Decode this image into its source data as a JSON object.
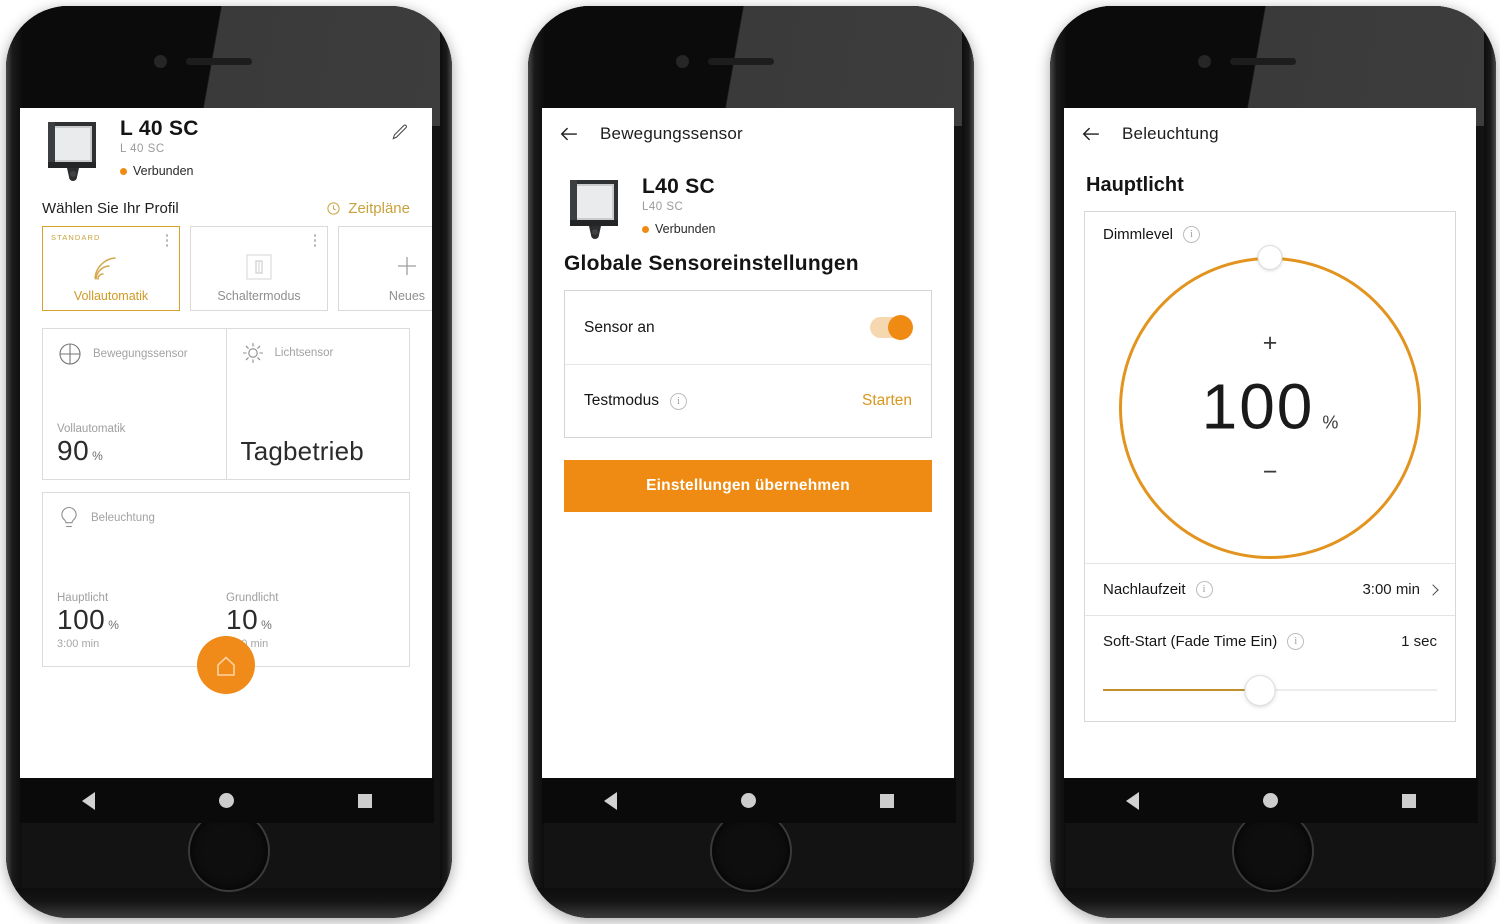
{
  "phone1": {
    "device": {
      "name": "L 40 SC",
      "model": "L 40 SC",
      "status": "Verbunden",
      "edit_icon": "pencil-icon",
      "image_alt": "steinel-outdoor-lamp"
    },
    "profile_section": {
      "label": "Wählen Sie Ihr Profil",
      "schedules_label": "Zeitpläne",
      "schedules_icon": "clock-icon",
      "cards": [
        {
          "tag": "STANDARD",
          "caption": "Vollautomatik",
          "icon": "motion-waves-icon",
          "active": true,
          "has_menu": true
        },
        {
          "tag": "",
          "caption": "Schaltermodus",
          "icon": "switch-icon",
          "active": false,
          "has_menu": true
        },
        {
          "tag": "",
          "caption": "Neues",
          "icon": "plus-icon",
          "active": false,
          "has_menu": false
        }
      ]
    },
    "sensor_card": {
      "motion": {
        "title": "Bewegungssensor",
        "icon": "crosshair-icon",
        "sub_label": "Vollautomatik",
        "value": "90",
        "unit": "%"
      },
      "light": {
        "title": "Lichtsensor",
        "icon": "sun-icon",
        "value": "Tagbetrieb"
      }
    },
    "lighting_card": {
      "title": "Beleuchtung",
      "icon": "bulb-icon",
      "items": [
        {
          "label": "Hauptlicht",
          "value": "100",
          "unit": "%",
          "time": "3:00 min"
        },
        {
          "label": "Grundlicht",
          "value": "10",
          "unit": "%",
          "time": "5:00 min"
        }
      ]
    },
    "fab": {
      "icon": "home-icon",
      "color": "#f08a18"
    }
  },
  "phone2": {
    "topbar": {
      "title": "Bewegungssensor",
      "back_icon": "arrow-left-icon"
    },
    "device": {
      "name": "L40 SC",
      "model": "L40 SC",
      "status": "Verbunden",
      "image_alt": "steinel-outdoor-lamp"
    },
    "heading": "Globale Sensoreinstellungen",
    "rows": [
      {
        "label": "Sensor an",
        "control": "toggle",
        "value": "on",
        "info": false
      },
      {
        "label": "Testmodus",
        "control": "link",
        "value": "Starten",
        "info": true,
        "info_icon": "info-icon"
      }
    ],
    "primary_button": "Einstellungen übernehmen"
  },
  "phone3": {
    "topbar": {
      "title": "Beleuchtung",
      "back_icon": "arrow-left-icon"
    },
    "heading": "Hauptlicht",
    "dimmer": {
      "label": "Dimmlevel",
      "info_icon": "info-icon",
      "value": "100",
      "unit": "%",
      "plus": "+",
      "minus": "−",
      "ring_color": "#e2941f",
      "knob_angle_deg": 0
    },
    "rows": [
      {
        "label": "Nachlaufzeit",
        "info_icon": "info-icon",
        "value": "3:00 min",
        "chevron": true
      },
      {
        "label": "Soft-Start (Fade Time Ein)",
        "info_icon": "info-icon",
        "value": "1 sec",
        "chevron": false
      }
    ],
    "slider": {
      "percent": 47,
      "fill_color": "#c08f2e"
    }
  },
  "navbar": {
    "back": "nav-back-icon",
    "home": "nav-home-icon",
    "recent": "nav-recent-icon"
  },
  "colors": {
    "accent": "#ef8b13",
    "accent_soft": "#d9a22c",
    "gold_text": "#c8a33c",
    "text": "#141414",
    "muted": "#9e9e9e"
  }
}
